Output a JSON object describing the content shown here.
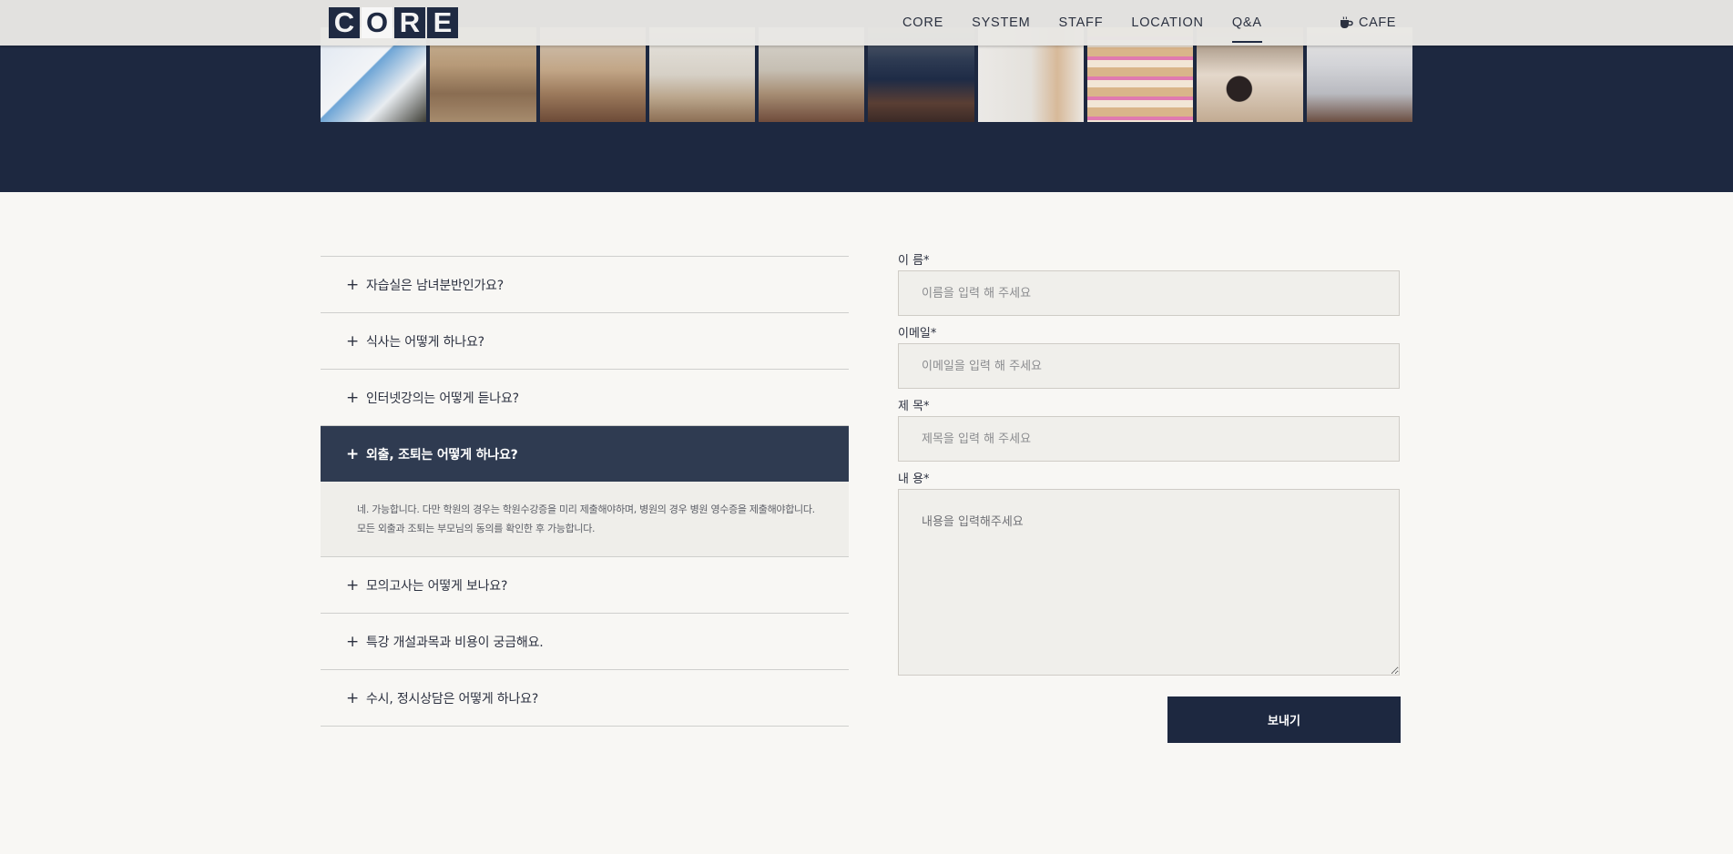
{
  "brand": {
    "letters": [
      "C",
      "O",
      "R",
      "E"
    ]
  },
  "nav": {
    "items": [
      {
        "label": "CORE"
      },
      {
        "label": "SYSTEM"
      },
      {
        "label": "STAFF"
      },
      {
        "label": "LOCATION"
      },
      {
        "label": "Q&A",
        "active": true
      }
    ],
    "cafe_label": "CAFE",
    "cafe_icon": "coffee-cup-icon"
  },
  "faq": {
    "items": [
      {
        "question": "자습실은 남녀분반인가요?",
        "open": false
      },
      {
        "question": "식사는 어떻게 하나요?",
        "open": false
      },
      {
        "question": "인터넷강의는 어떻게 듣나요?",
        "open": false
      },
      {
        "question": "외출, 조퇴는 어떻게 하나요?",
        "open": true,
        "answer_line1": "네. 가능합니다. 다만 학원의 경우는 학원수강증을 미리 제출해야하며, 병원의 경우 병원 영수증을 제출해야합니다.",
        "answer_line2": "모든 외출과 조퇴는 부모님의 동의를 확인한 후 가능합니다."
      },
      {
        "question": "모의고사는 어떻게 보나요?",
        "open": false
      },
      {
        "question": "특강 개설과목과 비용이 궁금해요.",
        "open": false
      },
      {
        "question": "수시, 정시상담은 어떻게 하나요?",
        "open": false
      }
    ],
    "toggle_symbol": "+"
  },
  "form": {
    "name_label": "이 름*",
    "name_placeholder": "이름을 입력 해 주세요",
    "email_label": "이메일*",
    "email_placeholder": "이메일을 입력 해 주세요",
    "subject_label": "제 목*",
    "subject_placeholder": "제목을 입력 해 주세요",
    "content_label": "내 용*",
    "content_placeholder": "내용을 입력해주세요",
    "submit_label": "보내기"
  },
  "colors": {
    "navy": "#1d2840",
    "accordion_active": "#2f3b51",
    "page_bg": "#f8f7f4",
    "input_bg": "#f0efeb"
  }
}
